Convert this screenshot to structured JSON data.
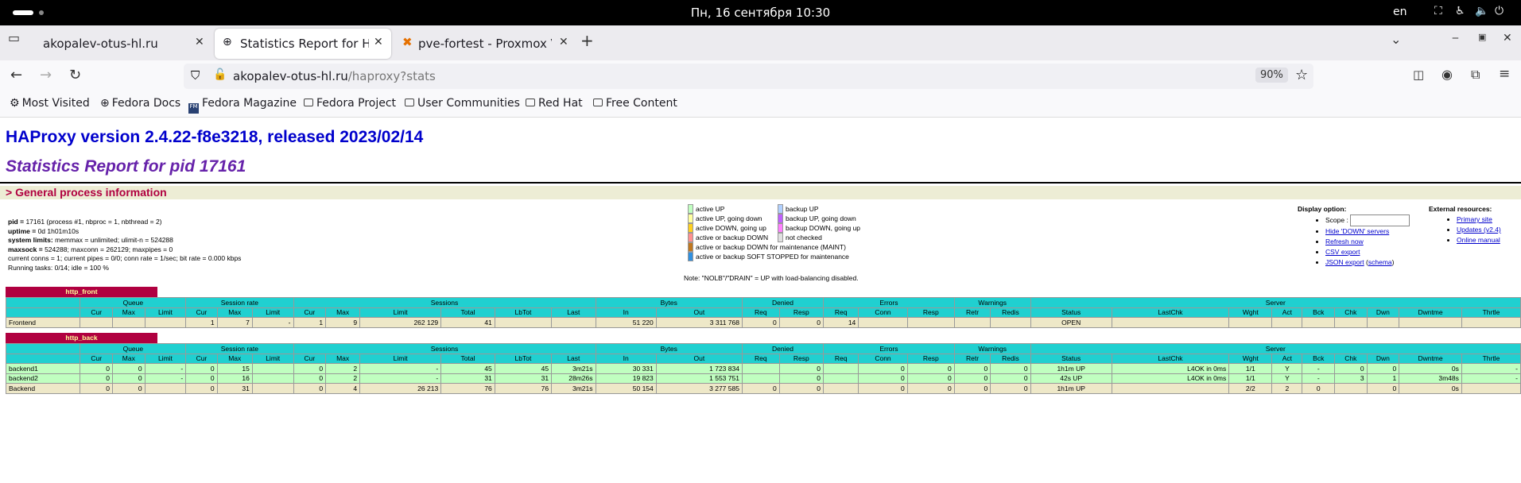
{
  "system": {
    "date_time": "Пн, 16 сентября  10:30",
    "lang": "en"
  },
  "browser": {
    "tabs": [
      {
        "label": "akopalev-otus-hl.ru"
      },
      {
        "label": "Statistics Report for HAProxy"
      },
      {
        "label": "pve-fortest - Proxmox Virtual"
      }
    ],
    "url_host": "akopalev-otus-hl.ru",
    "url_path": "/haproxy?stats",
    "zoom": "90%",
    "bookmarks": [
      "Most Visited",
      "Fedora Docs",
      "Fedora Magazine",
      "Fedora Project",
      "User Communities",
      "Red Hat",
      "Free Content"
    ]
  },
  "page": {
    "title": "HAProxy version 2.4.22-f8e3218, released 2023/02/14",
    "subtitle": "Statistics Report for pid 17161",
    "section": "> General process information",
    "info": [
      {
        "b": "pid = ",
        "t": "17161 (process #1, nbproc = 1, nbthread = 2)"
      },
      {
        "b": "uptime = ",
        "t": "0d 1h01m10s"
      },
      {
        "b": "system limits:",
        "t": " memmax = unlimited; ulimit-n = 524288"
      },
      {
        "b": "maxsock = ",
        "t": "524288; maxconn = 262129; maxpipes = 0"
      },
      {
        "b": "",
        "t": "current conns = 1; current pipes = 0/0; conn rate = 1/sec; bit rate = 0.000 kbps"
      },
      {
        "b": "",
        "t": "Running tasks: 0/14; idle = 100 %"
      }
    ],
    "legend": [
      {
        "label": "active UP",
        "color": "#c0ffc0"
      },
      {
        "label": "active UP, going down",
        "color": "#ffffa0"
      },
      {
        "label": "active DOWN, going up",
        "color": "#ffd020"
      },
      {
        "label": "active or backup DOWN",
        "color": "#ff9090"
      },
      {
        "label": "active or backup DOWN for maintenance (MAINT)",
        "color": "#c07820"
      },
      {
        "label": "active or backup SOFT STOPPED for maintenance",
        "color": "#3090e0"
      },
      {
        "label": "backup UP",
        "color": "#b0d0ff"
      },
      {
        "label": "backup UP, going down",
        "color": "#c060ff"
      },
      {
        "label": "backup DOWN, going up",
        "color": "#ff80ff"
      },
      {
        "label": "not checked",
        "color": "#e0e0e0"
      }
    ],
    "legend_note": "Note: \"NOLB\"/\"DRAIN\" = UP with load-balancing disabled.",
    "display_option": "Display option:",
    "scope_label": "Scope :",
    "options": [
      "Hide 'DOWN' servers",
      "Refresh now",
      "CSV export",
      "JSON export"
    ],
    "schema": "schema",
    "external_title": "External resources:",
    "external": [
      "Primary site",
      "Updates (v2.4)",
      "Online manual"
    ],
    "groups": [
      "",
      "Queue",
      "Session rate",
      "Sessions",
      "Bytes",
      "Denied",
      "Errors",
      "Warnings",
      "Server"
    ],
    "fe_cols": [
      "",
      "Cur",
      "Max",
      "Limit",
      "Cur",
      "Max",
      "Limit",
      "Cur",
      "Max",
      "Limit",
      "Total",
      "LbTot",
      "Last",
      "In",
      "Out",
      "Req",
      "Resp",
      "Req",
      "Conn",
      "Resp",
      "Retr",
      "Redis",
      "Status",
      "LastChk",
      "Wght",
      "Act",
      "Bck",
      "Chk",
      "Dwn",
      "Dwntme",
      "Thrtle"
    ],
    "be_cols": [
      "",
      "Cur",
      "Max",
      "Limit",
      "Cur",
      "Max",
      "Limit",
      "Cur",
      "Max",
      "Limit",
      "Total",
      "LbTot",
      "Last",
      "In",
      "Out",
      "Req",
      "Resp",
      "Req",
      "Conn",
      "Resp",
      "Retr",
      "Redis",
      "Status",
      "LastChk",
      "Wght",
      "Act",
      "Bck",
      "Chk",
      "Dwn",
      "Dwntme",
      "Thrtle"
    ],
    "frontend": {
      "name": "http_front",
      "rows": [
        [
          "Frontend",
          "",
          "",
          "",
          "1",
          "7",
          "-",
          "1",
          "9",
          "262 129",
          "41",
          "",
          "",
          "51 220",
          "3 311 768",
          "0",
          "0",
          "14",
          "",
          "",
          "",
          "",
          "OPEN",
          "",
          "",
          "",
          "",
          "",
          "",
          "",
          ""
        ]
      ]
    },
    "backend": {
      "name": "http_back",
      "rows": [
        [
          "backend1",
          "0",
          "0",
          "-",
          "0",
          "15",
          "",
          "0",
          "2",
          "-",
          "45",
          "45",
          "3m21s",
          "30 331",
          "1 723 834",
          "",
          "0",
          "",
          "0",
          "0",
          "0",
          "0",
          "1h1m UP",
          "L4OK in 0ms",
          "1/1",
          "Y",
          "-",
          "0",
          "0",
          "0s",
          "-"
        ],
        [
          "backend2",
          "0",
          "0",
          "-",
          "0",
          "16",
          "",
          "0",
          "2",
          "-",
          "31",
          "31",
          "28m26s",
          "19 823",
          "1 553 751",
          "",
          "0",
          "",
          "0",
          "0",
          "0",
          "0",
          "42s UP",
          "L4OK in 0ms",
          "1/1",
          "Y",
          "-",
          "3",
          "1",
          "3m48s",
          "-"
        ],
        [
          "Backend",
          "0",
          "0",
          "",
          "0",
          "31",
          "",
          "0",
          "4",
          "26 213",
          "76",
          "76",
          "3m21s",
          "50 154",
          "3 277 585",
          "0",
          "0",
          "",
          "0",
          "0",
          "0",
          "0",
          "1h1m UP",
          "",
          "2/2",
          "2",
          "0",
          "",
          "0",
          "0s",
          ""
        ]
      ]
    }
  }
}
